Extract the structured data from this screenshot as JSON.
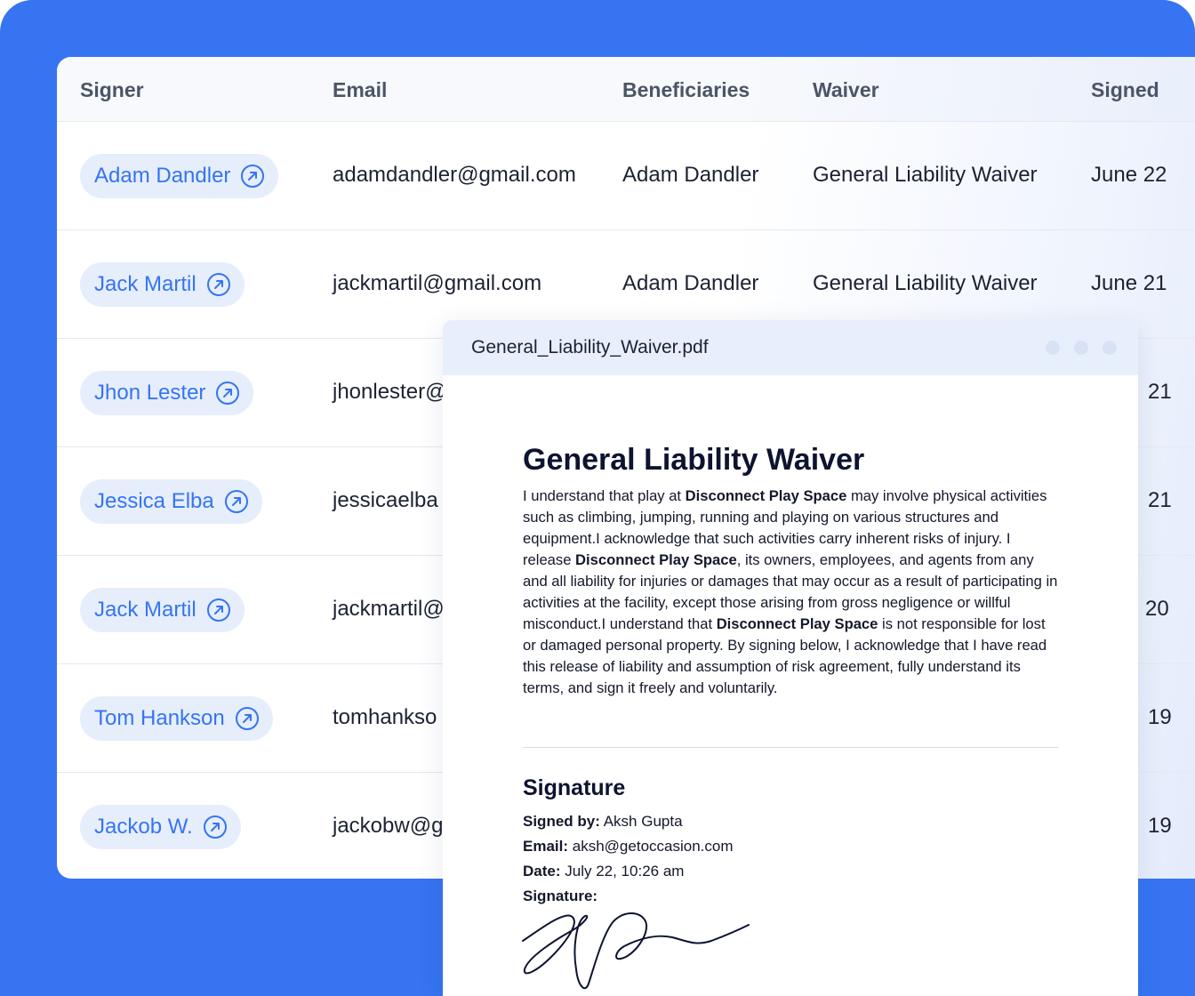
{
  "table": {
    "columns": [
      "Signer",
      "Email",
      "Beneficiaries",
      "Waiver",
      "Signed"
    ],
    "rows": [
      {
        "signer": "Adam Dandler",
        "email": "adamdandler@gmail.com",
        "beneficiaries": "Adam Dandler",
        "waiver": "General Liability Waiver",
        "signed": "June 22"
      },
      {
        "signer": "Jack Martil",
        "email": "jackmartil@gmail.com",
        "beneficiaries": "Adam Dandler",
        "waiver": "General Liability Waiver",
        "signed": "June 21"
      },
      {
        "signer": "Jhon Lester",
        "email": "jhonlester@",
        "signed": "21"
      },
      {
        "signer": "Jessica Elba",
        "email": "jessicaelba",
        "signed": "21"
      },
      {
        "signer": "Jack Martil",
        "email": "jackmartil@",
        "signed": "20"
      },
      {
        "signer": "Tom Hankson",
        "email": "tomhankso",
        "signed": "19"
      },
      {
        "signer": "Jackob W.",
        "email": "jackobw@g",
        "signed": "19"
      }
    ]
  },
  "pdf": {
    "filename": "General_Liability_Waiver.pdf",
    "title": "General Liability Waiver",
    "body": [
      {
        "t": "I understand that play at "
      },
      {
        "t": "Disconnect Play Space",
        "b": true
      },
      {
        "t": " may involve physical activities such as climbing, jumping, running and playing on various structures and equipment.I acknowledge that such activities carry inherent risks of injury. I release "
      },
      {
        "t": "Disconnect Play Space",
        "b": true
      },
      {
        "t": ", its owners, employees, and agents from any and all liability for injuries or damages that may occur as a result of participating in activities at the facility, except those arising from gross negligence or willful misconduct.I understand that "
      },
      {
        "t": "Disconnect Play Space",
        "b": true
      },
      {
        "t": " is not responsible for lost or damaged personal property. By signing below, I acknowledge that I have read this release of liability and assumption of risk agreement, fully understand its terms, and sign it freely and voluntarily."
      }
    ],
    "signature": {
      "heading": "Signature",
      "signed_by_label": "Signed by:",
      "signed_by": "Aksh Gupta",
      "email_label": "Email:",
      "email": "aksh@getoccasion.com",
      "date_label": "Date:",
      "date": "July 22, 10:26 am",
      "signature_label": "Signature:"
    }
  },
  "colors": {
    "brand_blue": "#3674f2",
    "chip_bg": "#e6eefc",
    "text_dark": "#1d2233"
  }
}
